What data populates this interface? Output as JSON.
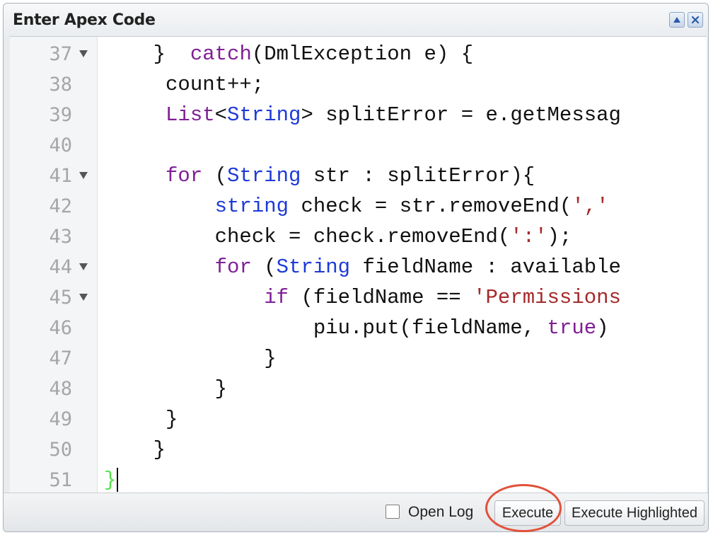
{
  "window": {
    "title": "Enter Apex Code",
    "buttons": {
      "collapse_icon": "triangle-up-icon",
      "close_icon": "close-x-icon"
    }
  },
  "editor": {
    "lines": [
      {
        "num": "37",
        "fold": true
      },
      {
        "num": "38",
        "fold": false
      },
      {
        "num": "39",
        "fold": false
      },
      {
        "num": "40",
        "fold": false
      },
      {
        "num": "41",
        "fold": true
      },
      {
        "num": "42",
        "fold": false
      },
      {
        "num": "43",
        "fold": false
      },
      {
        "num": "44",
        "fold": true
      },
      {
        "num": "45",
        "fold": true
      },
      {
        "num": "46",
        "fold": false
      },
      {
        "num": "47",
        "fold": false
      },
      {
        "num": "48",
        "fold": false
      },
      {
        "num": "49",
        "fold": false
      },
      {
        "num": "50",
        "fold": false
      },
      {
        "num": "51",
        "fold": false
      }
    ],
    "code": {
      "l37_pre": "    }  ",
      "l37_kw": "catch",
      "l37_post": "(DmlException e) {",
      "l38": "     count++;",
      "l39_pre": "     ",
      "l39_kw1": "List",
      "l39_mid": "<",
      "l39_kw2": "String",
      "l39_post": "> splitError = e.getMessag",
      "l40": "",
      "l41_pre": "     ",
      "l41_kw1": "for",
      "l41_mid": " (",
      "l41_kw2": "String",
      "l41_post": " str : splitError){",
      "l42_pre": "         ",
      "l42_kw": "string",
      "l42_mid": " check = str.removeEnd(",
      "l42_str": "','",
      "l43_pre": "         check = check.removeEnd(",
      "l43_str": "':'",
      "l43_post": ");",
      "l44_pre": "         ",
      "l44_kw1": "for",
      "l44_mid": " (",
      "l44_kw2": "String",
      "l44_post": " fieldName : available",
      "l45_pre": "             ",
      "l45_kw": "if",
      "l45_mid": " (fieldName == ",
      "l45_str": "'Permissions",
      "l46_pre": "                 piu.put(fieldName, ",
      "l46_kw": "true",
      "l46_post": ")",
      "l47": "             }",
      "l48": "         }",
      "l49": "     }",
      "l50": "    }",
      "l51": "}"
    }
  },
  "footer": {
    "open_log_label": "Open Log",
    "open_log_checked": false,
    "execute_label": "Execute",
    "execute_highlighted_label": "Execute Highlighted",
    "annotation_color": "#e2513b"
  }
}
